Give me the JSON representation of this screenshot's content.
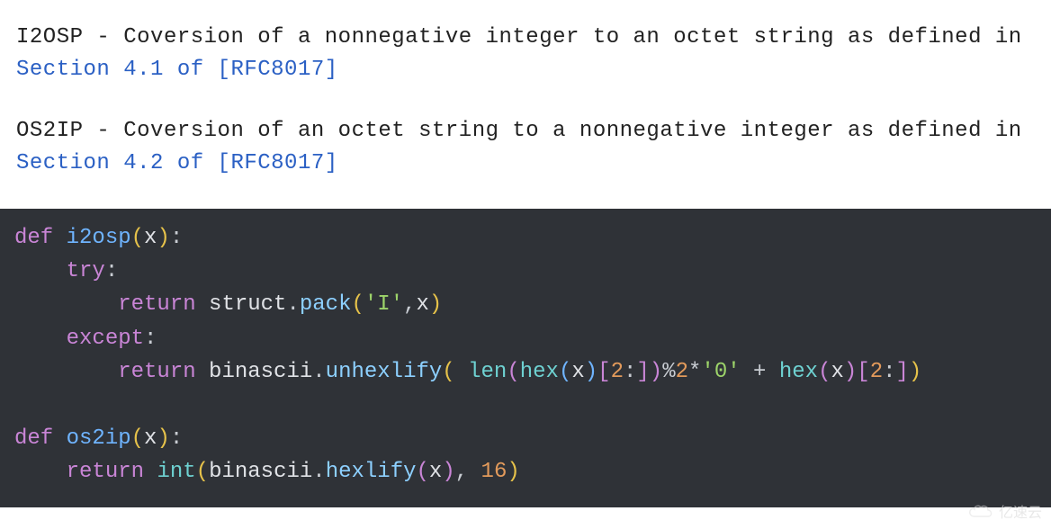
{
  "doc": {
    "i2osp": {
      "name": "I2OSP",
      "dash": " - ",
      "desc": "Coversion of a nonnegative integer to an octet string as defined in ",
      "link": "Section 4.1 of [RFC8017]"
    },
    "os2ip": {
      "name": "OS2IP",
      "dash": " - ",
      "desc": "Coversion of an octet string to a nonnegative integer as defined in ",
      "link": "Section 4.2 of [RFC8017]"
    }
  },
  "code": {
    "kw_def": "def",
    "kw_try": "try",
    "kw_except": "except",
    "kw_return": "return",
    "fn_i2osp": "i2osp",
    "fn_os2ip": "os2ip",
    "var_x": "x",
    "mod_struct": "struct",
    "attr_pack": "pack",
    "mod_binascii": "binascii",
    "attr_unhexlify": "unhexlify",
    "attr_hexlify": "hexlify",
    "builtin_len": "len",
    "builtin_hex": "hex",
    "builtin_int": "int",
    "str_I": "'I'",
    "str_zero": "'0'",
    "num_2": "2",
    "num_16": "16",
    "slice_2": "2",
    "colon": ":",
    "comma": ",",
    "dot": ".",
    "plus": "+",
    "star": "*",
    "percent": "%",
    "lpar": "(",
    "rpar": ")",
    "lbr": "[",
    "rbr": "]"
  },
  "watermark": {
    "text": "亿速云"
  }
}
